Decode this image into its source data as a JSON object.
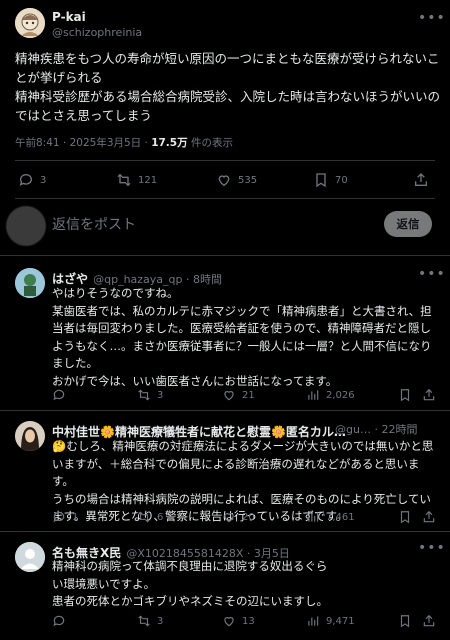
{
  "main_post": {
    "name": "P-kai",
    "handle": "@schizophreinia",
    "body": "精神疾患をもつ人の寿命が短い原因の一つにまともな医療が受けられないことが挙げられる\n精神科受診歴がある場合総合病院受診、入院した時は言わないほうがいいのではとさえ思ってしまう",
    "timestamp": "午前8:41 · 2025年3月5日 · ",
    "views": "17.5万",
    "views_suffix": " 件の表示",
    "stats": {
      "replies": "3",
      "reposts": "121",
      "likes": "535",
      "bookmarks": "70"
    }
  },
  "reply_box": {
    "placeholder": "返信をポスト",
    "button_label": "返信"
  },
  "replies": [
    {
      "name": "はざや",
      "handle": "@qp_hazaya_qp · 8時間",
      "body": "やはりそうなのですね。\n某歯医者では、私のカルテに赤マジックで「精神病患者」と大書され、担当者は毎回変わりました。医療受給者証を使うので、精神障碍者だと隠しようもなく…。まさか医療従事者に？一般人には一層？と人間不信になりました。\nおかげで今は、いい歯医者さんにお世話になってます。",
      "stats": {
        "replies": "",
        "reposts": "3",
        "likes": "21",
        "views": "2,026"
      }
    },
    {
      "name": "中村佳世🌼精神医療犠牲者に献花と慰霊🌼匿名カル…",
      "handle": "@gu… · 22時間",
      "body": "🤔むしろ、精神医療の対症療法によるダメージが大きいのでは無いかと思いますが、＋総合科での偏見による診断治療の遅れなどがあると思います。\nうちの場合は精神科病院の説明によれば、医療そのものにより死亡しています。異常死となり、警察に報告は行っているはずです。",
      "stats": {
        "replies": "1",
        "reposts": "6",
        "likes": "20",
        "views": "7,461"
      }
    },
    {
      "name": "名も無きX民",
      "handle": "@X1021845581428X · 3月5日",
      "body": "精神科の病院って体調不良理由に退院する奴出るぐらい環境悪いですよ。\n患者の死体とかゴキブリやネズミその辺にいますし。",
      "stats": {
        "replies": "",
        "reposts": "3",
        "likes": "13",
        "views": "9,471"
      }
    }
  ],
  "icons": [
    "more-icon",
    "reply-icon",
    "repost-icon",
    "like-icon",
    "bookmark-icon",
    "share-icon",
    "views-icon"
  ],
  "colors": {
    "background": "#000000",
    "text": "#e7e9ea",
    "muted": "#71767b",
    "divider": "#2f3336",
    "reply_button_bg": "#787a7a"
  }
}
